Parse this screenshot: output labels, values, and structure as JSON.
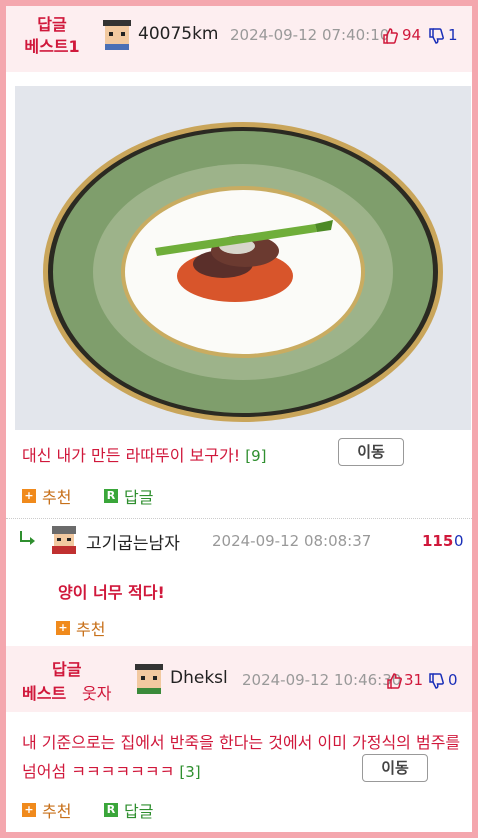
{
  "post": {
    "best_label_line1": "답글",
    "best_label_line2": "베스트1",
    "author": "40075km",
    "timestamp": "2024-09-12 07:40:10",
    "upvotes": "94",
    "downvotes": "1",
    "title": "대신 내가 만든 라따뚜이 보구가!",
    "comment_count": "[9]",
    "move_label": "이동",
    "recommend_label": "추천",
    "reply_label": "답글"
  },
  "reply": {
    "author": "고기굽는남자",
    "timestamp": "2024-09-12 08:08:37",
    "upvotes": "115",
    "downvotes": "0",
    "body": "양이 너무 적다!",
    "recommend_label": "추천"
  },
  "second_post": {
    "best_label_line1": "답글",
    "best_label_line2": "베스트",
    "best_label_suffix": "웃자",
    "author": "Dheksl",
    "timestamp": "2024-09-12 10:46:30",
    "upvotes": "31",
    "downvotes": "0",
    "body": "내 기준으로는 집에서 반죽을 한다는 것에서 이미 가정식의 범주를 넘어섬 ㅋㅋㅋㅋㅋㅋㅋ",
    "comment_count": "[3]",
    "move_label": "이동",
    "recommend_label": "추천",
    "reply_label": "답글"
  },
  "colors": {
    "accent_red": "#d0183b",
    "header_bg": "#fdeef0",
    "frame_border": "#f4a7ae",
    "comment_green": "#2f8f2f",
    "vote_down_blue": "#1a2fb8"
  },
  "icons": {
    "thumbs_up": "thumbs-up-icon",
    "thumbs_down": "thumbs-down-icon",
    "plus": "plus-box-icon",
    "reply": "reply-box-icon",
    "reply_arrow": "reply-arrow-icon",
    "avatar": "pixel-avatar-icon"
  }
}
